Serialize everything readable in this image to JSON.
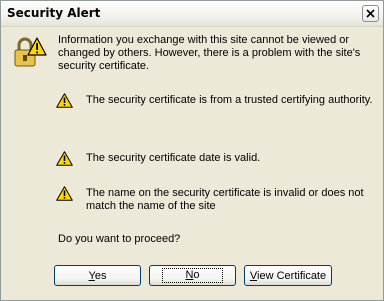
{
  "window": {
    "title": "Security Alert"
  },
  "message": {
    "intro": "Information you exchange with this site cannot be viewed or changed by others. However, there is a problem with the site's security certificate.",
    "items": [
      {
        "icon": "warning-icon",
        "text": "The security certificate is from a trusted certifying authority."
      },
      {
        "icon": "warning-icon",
        "text": "The security certificate date is valid."
      },
      {
        "icon": "warning-icon",
        "text": "The name on the security certificate is invalid or does not match the name of the site"
      }
    ],
    "question": "Do you want to proceed?"
  },
  "buttons": {
    "yes": {
      "first": "Y",
      "rest": "es"
    },
    "no": {
      "first": "N",
      "rest": "o"
    },
    "view": {
      "first": "V",
      "rest": "iew Certificate"
    }
  },
  "icons": {
    "main": "padlock-warning-icon",
    "close": "close-icon"
  },
  "colors": {
    "dialog_bg": "#ece9d8",
    "warning_yellow": "#ffd800",
    "button_border": "#003c74"
  }
}
